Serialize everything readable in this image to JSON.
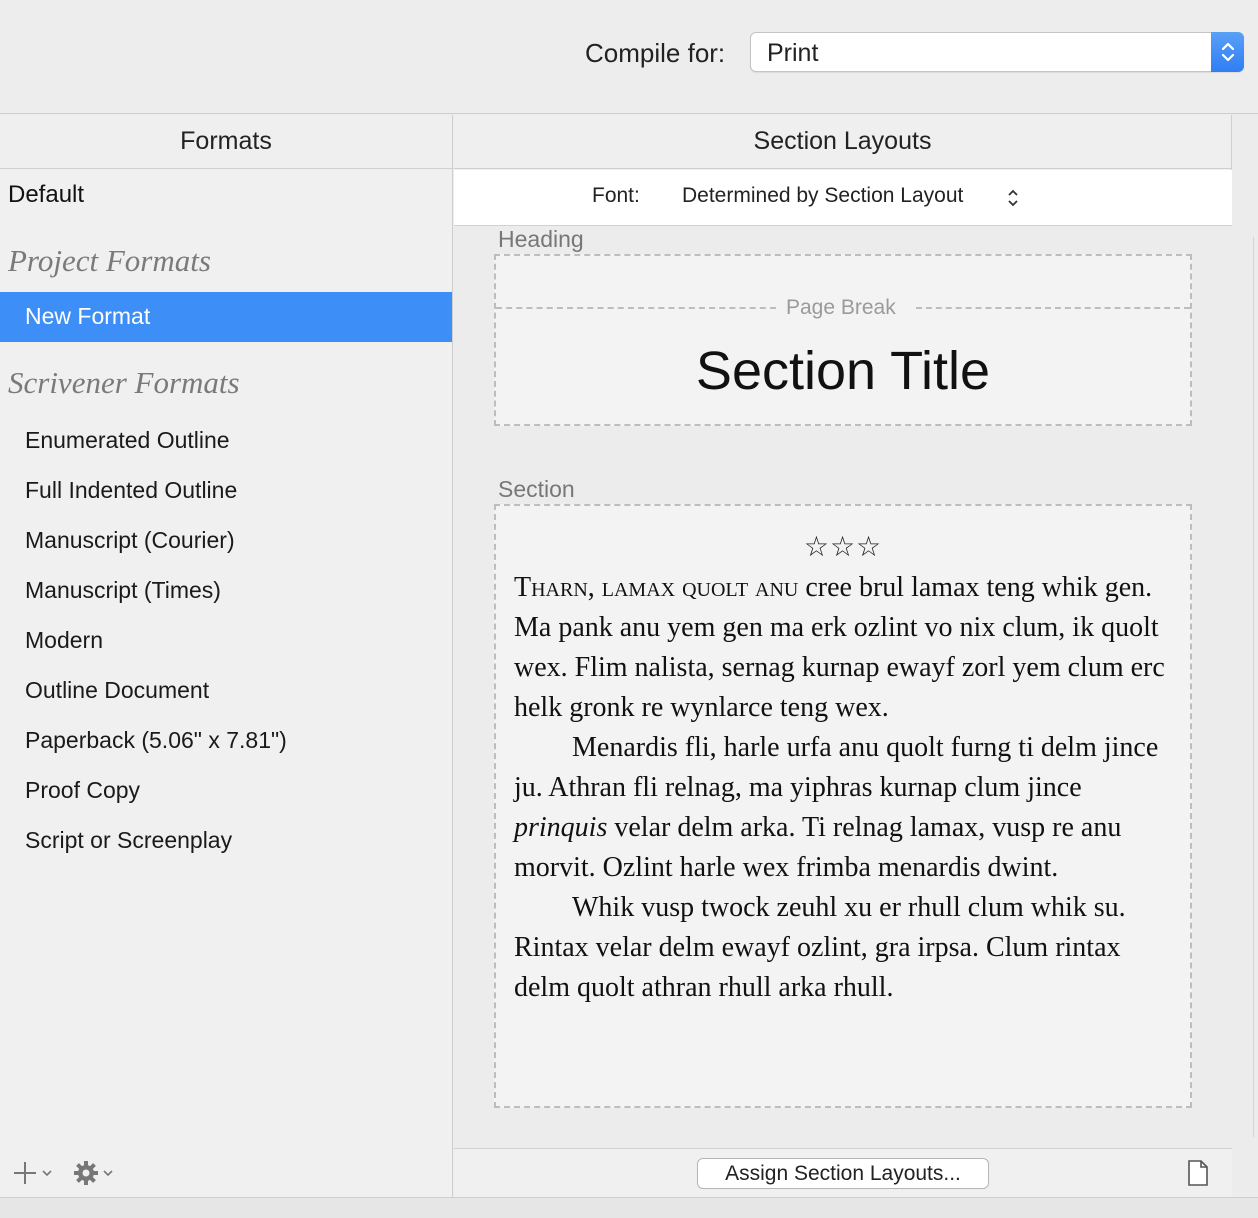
{
  "toolbar": {
    "compile_label": "Compile for:",
    "compile_value": "Print"
  },
  "formats": {
    "header": "Formats",
    "default_label": "Default",
    "project_group": "Project Formats",
    "selected": "New Format",
    "scrivener_group": "Scrivener Formats",
    "items": [
      "Enumerated Outline",
      "Full Indented Outline",
      "Manuscript (Courier)",
      "Manuscript (Times)",
      "Modern",
      "Outline Document",
      "Paperback (5.06\" x 7.81\")",
      "Proof Copy",
      "Script or Screenplay"
    ]
  },
  "layouts": {
    "header": "Section Layouts",
    "font_label": "Font:",
    "font_value": "Determined by Section Layout",
    "heading_label": "Heading",
    "page_break": "Page Break",
    "section_title": "Section Title",
    "section_label": "Section",
    "stars": "☆☆☆",
    "p1_smallcaps": "Tharn, lamax quolt anu",
    "p1_rest": " cree brul lamax teng whik gen. Ma pank anu yem gen ma erk ozlint vo nix clum, ik quolt wex. Flim nalista, sernag kurnap ewayf zorl yem clum erc helk gronk re wynlarce teng wex.",
    "p2_start": "Menardis fli, harle urfa anu quolt furng ti delm jince ju. Athran fli relnag, ma yiphras kurnap clum jince ",
    "p2_italic": "prinquis",
    "p2_end": " velar delm arka. Ti relnag lamax, vusp re anu morvit. Ozlint harle wex frimba menardis dwint.",
    "p3": "Whik vusp twock zeuhl xu er rhull clum whik su. Rintax velar delm ewayf ozlint, gra irpsa. Clum rintax delm quolt athran rhull arka rhull.",
    "assign_button": "Assign Section Layouts..."
  },
  "colors": {
    "accent": "#3d8ef7",
    "background": "#ececec"
  },
  "icons": [
    "chevron-updown-icon",
    "plus-icon",
    "gear-icon",
    "chevron-down-icon",
    "page-icon"
  ]
}
